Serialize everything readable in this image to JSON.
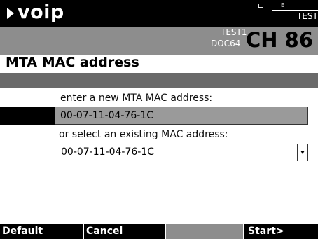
{
  "header": {
    "title": "voip",
    "status_text": "TEST",
    "battery_letter": "E"
  },
  "channel": {
    "sub1": "TEST1",
    "sub2": "DOC64",
    "name": "CH 86"
  },
  "page": {
    "title": "MTA MAC address"
  },
  "form": {
    "new_mac_label": "enter a new MTA MAC address:",
    "new_mac_value": "00-07-11-04-76-1C",
    "existing_mac_label": "or select an existing MAC address:",
    "existing_mac_selected": "00-07-11-04-76-1C"
  },
  "softkeys": {
    "key1": "Default",
    "key2": "Cancel",
    "key3": "",
    "key4": "Start>"
  }
}
